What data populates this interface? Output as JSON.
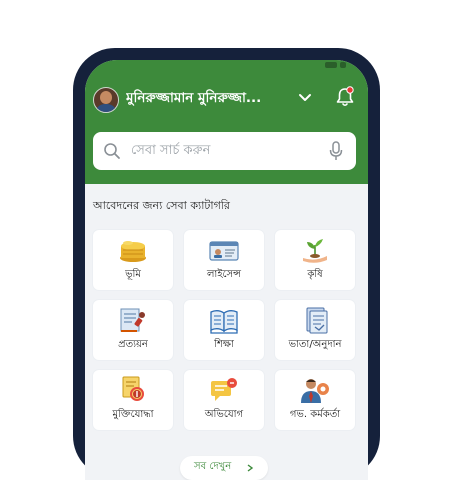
{
  "header": {
    "user_name": "মুনিরুজ্জামান মুনিরুজ্জা...",
    "search_placeholder": "সেবা সার্চ করুন"
  },
  "section": {
    "title": "আবেদনের জন্য সেবা ক্যাটাগরি"
  },
  "categories": [
    {
      "label": "ভূমি",
      "icon": "land-coins-icon"
    },
    {
      "label": "লাইসেন্স",
      "icon": "license-card-icon"
    },
    {
      "label": "কৃষি",
      "icon": "agriculture-plant-icon"
    },
    {
      "label": "প্রত্যয়ন",
      "icon": "certificate-stamp-icon"
    },
    {
      "label": "শিক্ষা",
      "icon": "education-book-icon"
    },
    {
      "label": "ভাতা/অনুদান",
      "icon": "allowance-document-icon"
    },
    {
      "label": "মুক্তিযোদ্ধা",
      "icon": "freedom-fighter-medal-icon"
    },
    {
      "label": "অভিযোগ",
      "icon": "complaint-chat-icon"
    },
    {
      "label": "গভ. কর্মকর্তা",
      "icon": "government-officer-icon"
    }
  ],
  "more_button": {
    "label": "সব দেখুন"
  },
  "colors": {
    "brand_green": "#3d8a3b",
    "phone_frame": "#15213b",
    "notification_dot": "#e53935"
  }
}
